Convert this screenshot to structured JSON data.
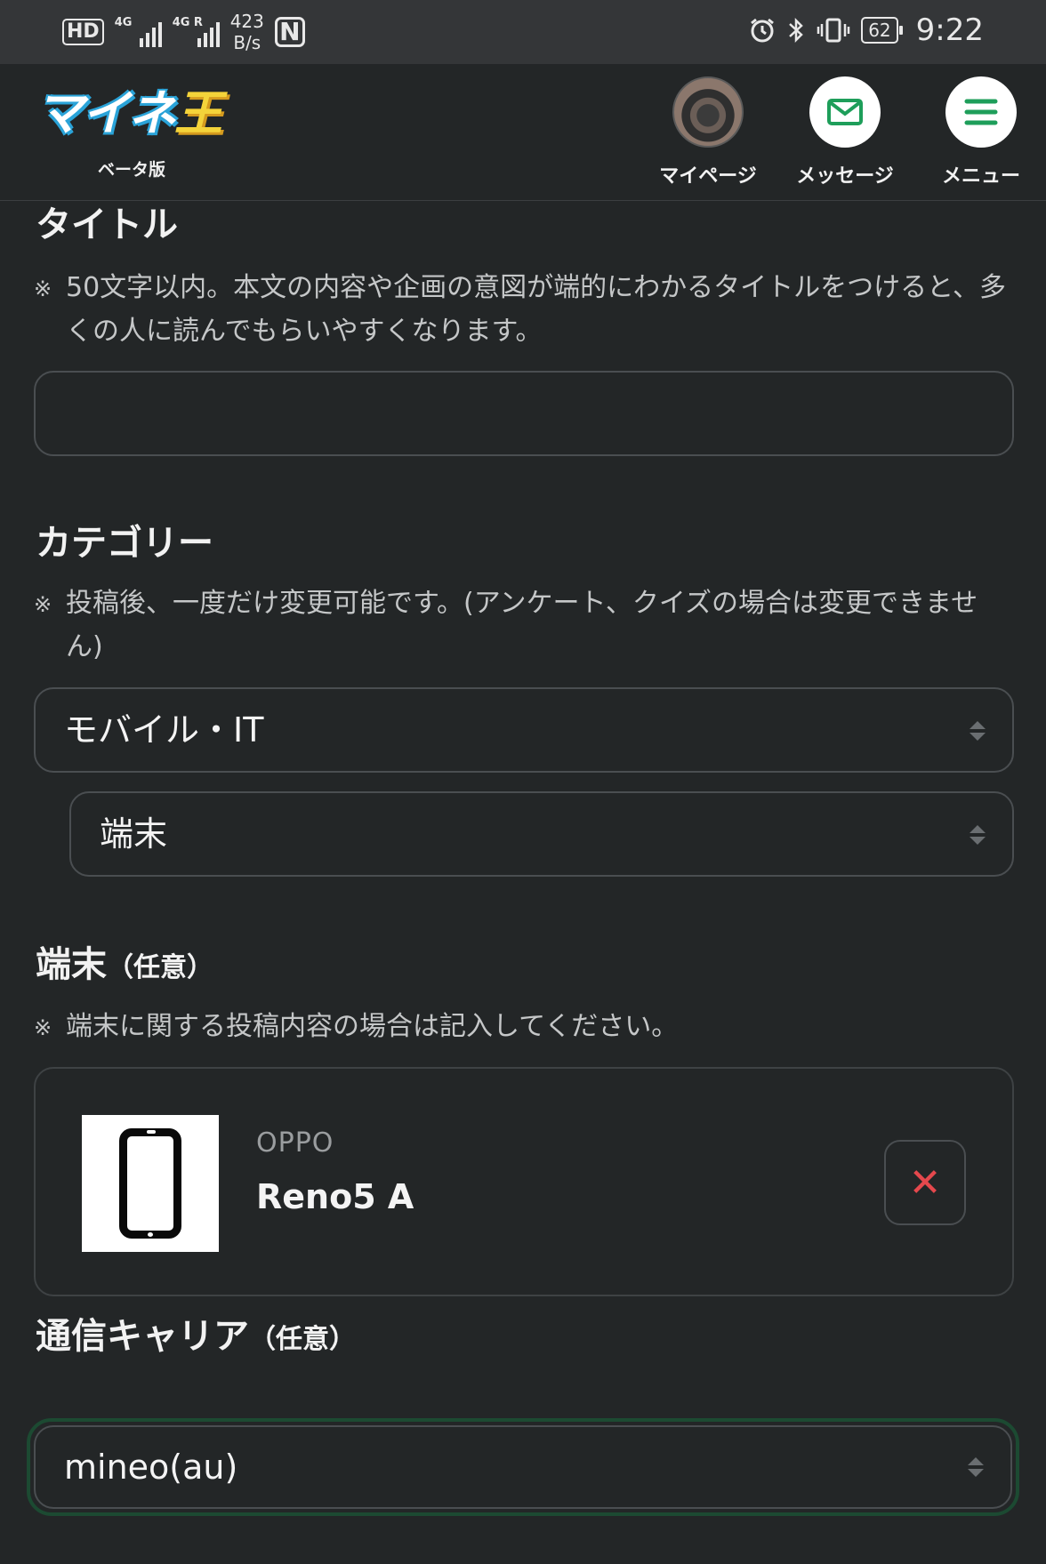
{
  "status_bar": {
    "hd": "HD",
    "net1": "4G",
    "net2": "4G R",
    "speed_value": "423",
    "speed_unit": "B/s",
    "nfc": "N",
    "battery": "62",
    "time": "9:22",
    "icons": [
      "alarm-icon",
      "bluetooth-icon",
      "vibrate-icon",
      "battery-icon"
    ]
  },
  "header": {
    "logo_text": "マイネ",
    "logo_accent": "王",
    "logo_sub": "ベータ版",
    "nav": [
      {
        "label": "マイページ",
        "icon": "avatar"
      },
      {
        "label": "メッセージ",
        "icon": "mail-icon"
      },
      {
        "label": "メニュー",
        "icon": "hamburger-menu-icon"
      }
    ],
    "colors": {
      "logo_blue": "#2aa3d8",
      "logo_yellow": "#f4d33a",
      "icon_green": "#1e9e5a"
    }
  },
  "form": {
    "title_section": {
      "heading": "タイトル",
      "note_mark": "※",
      "note": "50文字以内。本文の内容や企画の意図が端的にわかるタイトルをつけると、多くの人に読んでもらいやすくなります。",
      "value": ""
    },
    "category_section": {
      "heading": "カテゴリー",
      "note_mark": "※",
      "note": "投稿後、一度だけ変更可能です。(アンケート、クイズの場合は変更できません)",
      "main_value": "モバイル・IT",
      "sub_value": "端末"
    },
    "device_section": {
      "heading": "端末",
      "heading_opt": "（任意）",
      "note_mark": "※",
      "note": "端末に関する投稿内容の場合は記入してください。",
      "maker": "OPPO",
      "name": "Reno5 A",
      "remove_glyph": "✕",
      "remove_color": "#e5484d"
    },
    "carrier_section": {
      "heading": "通信キャリア",
      "heading_opt": "（任意）",
      "value": "mineo(au)",
      "focus_color": "#1c4a32"
    }
  }
}
